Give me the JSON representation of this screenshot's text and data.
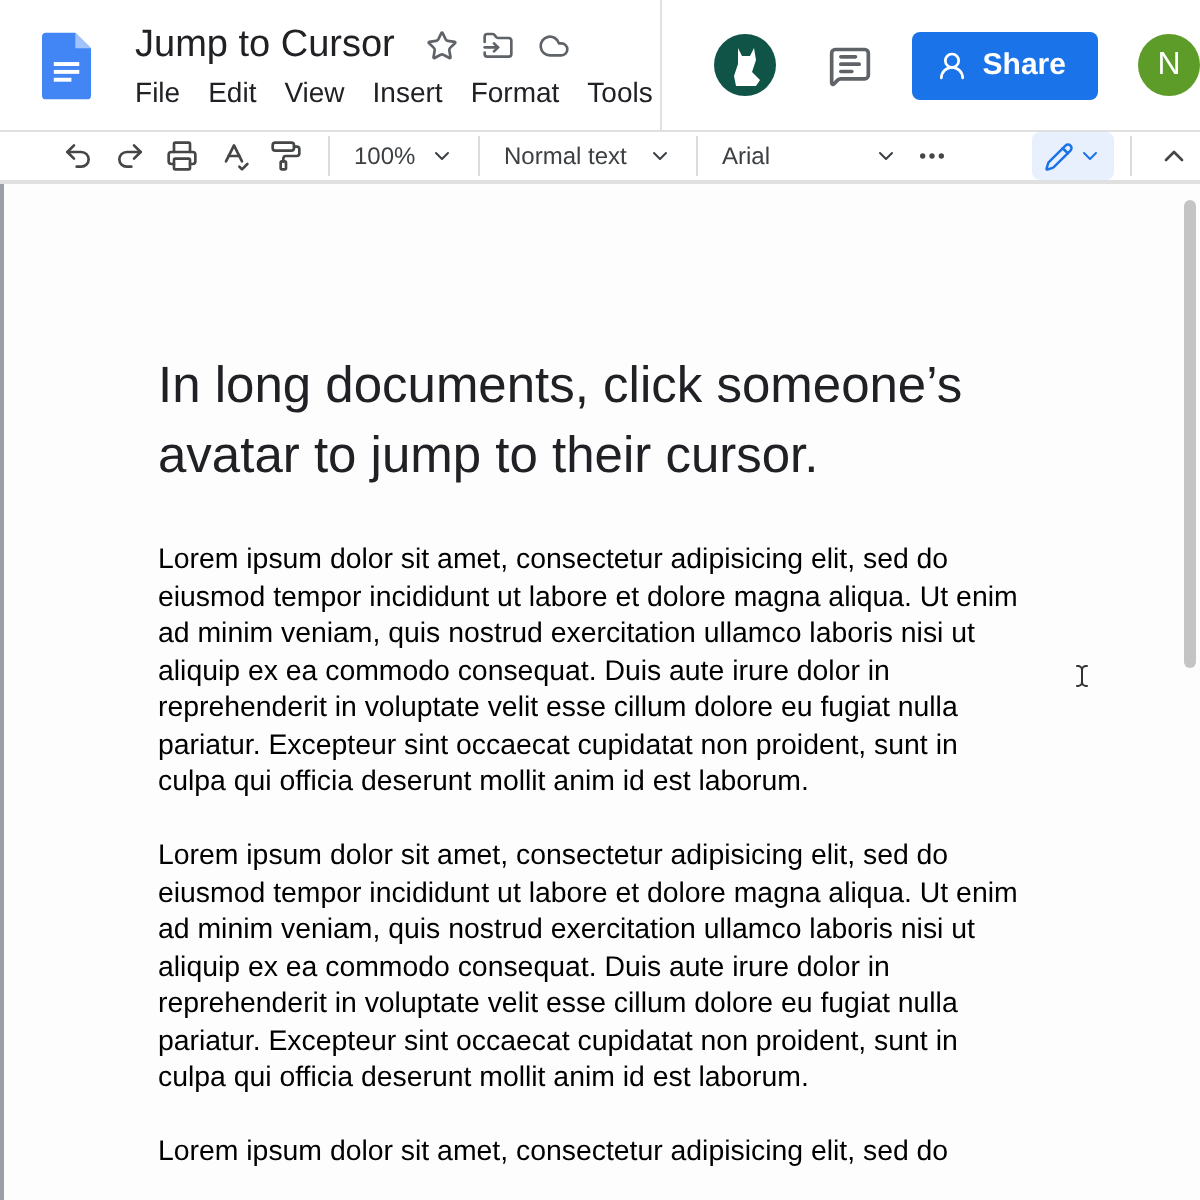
{
  "document": {
    "title": "Jump to Cursor",
    "starred": false
  },
  "menu": [
    "File",
    "Edit",
    "View",
    "Insert",
    "Format",
    "Tools"
  ],
  "share": {
    "label": "Share"
  },
  "user": {
    "initial": "N"
  },
  "toolbar": {
    "zoom": "100%",
    "style": "Normal text",
    "font": "Arial"
  },
  "heading": "In long documents, click someone’s avatar to jump to their cursor.",
  "paragraphs": [
    "Lorem ipsum dolor sit amet, consectetur adipisicing elit, sed do eiusmod tempor incididunt ut labore et dolore magna aliqua. Ut enim ad minim veniam, quis nostrud exercitation ullamco laboris nisi ut aliquip ex ea commodo consequat. Duis aute irure dolor in reprehenderit in voluptate velit esse cillum dolore eu fugiat nulla pariatur. Excepteur sint occaecat cupidatat non proident, sunt in culpa qui officia deserunt mollit anim id est laborum.",
    "Lorem ipsum dolor sit amet, consectetur adipisicing elit, sed do eiusmod tempor incididunt ut labore et dolore magna aliqua. Ut enim ad minim veniam, quis nostrud exercitation ullamco laboris nisi ut aliquip ex ea commodo consequat. Duis aute irure dolor in reprehenderit in voluptate velit esse cillum dolore eu fugiat nulla pariatur. Excepteur sint occaecat cupidatat non proident, sunt in culpa qui officia deserunt mollit anim id est laborum.",
    "Lorem ipsum dolor sit amet, consectetur adipisicing elit, sed do"
  ]
}
